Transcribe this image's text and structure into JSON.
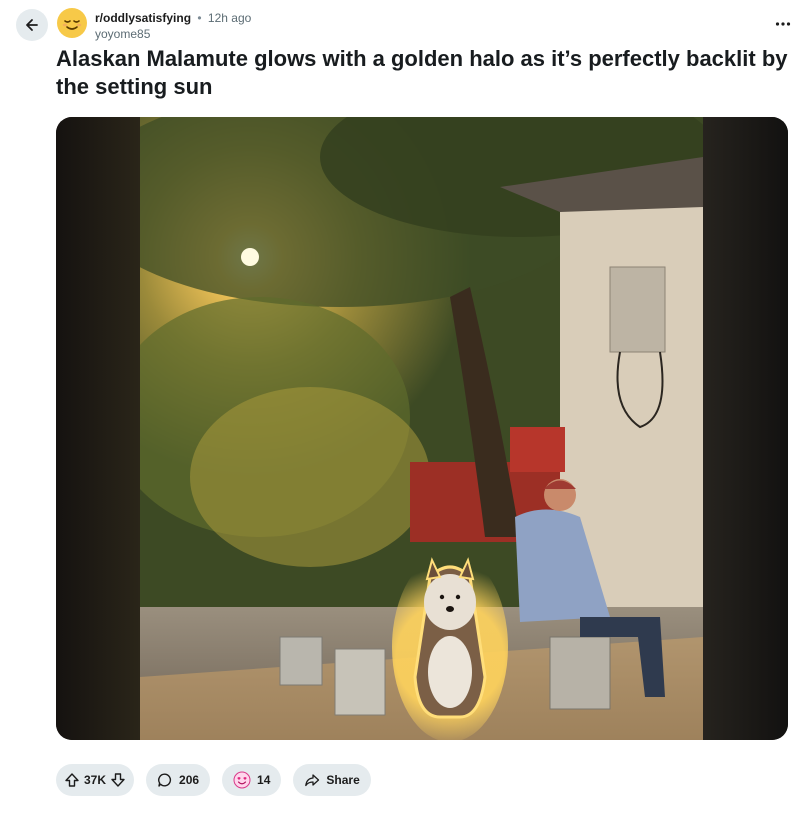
{
  "post": {
    "subreddit": "r/oddlysatisfying",
    "separator": "•",
    "time_ago": "12h ago",
    "author": "yoyome85",
    "title": "Alaskan Malamute glows with a golden halo as it’s perfectly backlit by the setting sun"
  },
  "actions": {
    "votes": "37K",
    "comments": "206",
    "awards": "14",
    "share_label": "Share"
  },
  "icons": {
    "back": "arrow-left-icon",
    "subreddit_avatar": "relieved-face-icon",
    "more": "ellipsis-icon",
    "upvote": "upvote-arrow-icon",
    "downvote": "downvote-arrow-icon",
    "comment": "comment-bubble-icon",
    "award": "heart-eyes-award-icon",
    "share": "share-arrow-icon"
  },
  "colors": {
    "pill_background": "#e5ebee",
    "avatar_yellow": "#f7c948",
    "sunlight": "#ffd35c",
    "text_primary": "#1c1c1c",
    "text_secondary": "#5c6c74"
  }
}
